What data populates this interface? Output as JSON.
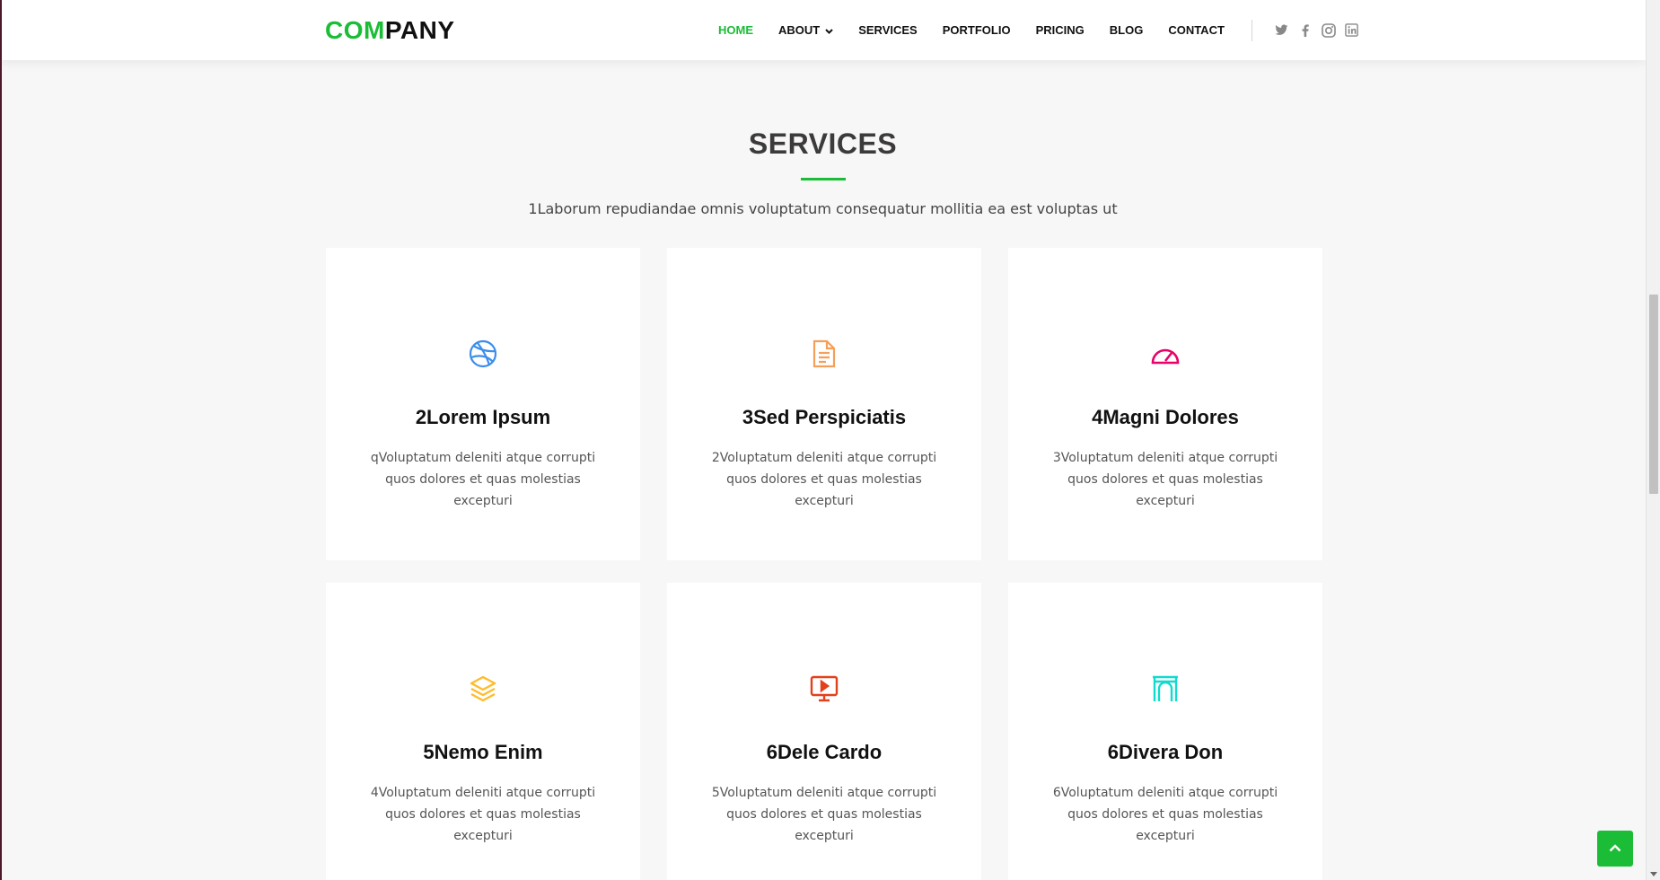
{
  "header": {
    "logo_part1": "COM",
    "logo_part2": "PANY",
    "nav": {
      "home": "HOME",
      "about": "ABOUT",
      "services": "SERVICES",
      "portfolio": "PORTFOLIO",
      "pricing": "PRICING",
      "blog": "BLOG",
      "contact": "CONTACT"
    },
    "social_icons": [
      "twitter-icon",
      "facebook-icon",
      "instagram-icon",
      "linkedin-icon"
    ]
  },
  "section": {
    "title": "SERVICES",
    "subtitle": "1Laborum repudiandae omnis voluptatum consequatur mollitia ea est voluptas ut"
  },
  "cards": [
    {
      "icon": "dribbble-icon",
      "color": "#3b8eea",
      "title": "2Lorem Ipsum",
      "desc": "qVoluptatum deleniti atque corrupti quos dolores et quas molestias excepturi"
    },
    {
      "icon": "document-icon",
      "color": "#f5a05a",
      "title": "3Sed Perspiciatis",
      "desc": "2Voluptatum deleniti atque corrupti quos dolores et quas molestias excepturi"
    },
    {
      "icon": "speedometer-icon",
      "color": "#e80368",
      "title": "4Magni Dolores",
      "desc": "3Voluptatum deleniti atque corrupti quos dolores et quas molestias excepturi"
    },
    {
      "icon": "layers-icon",
      "color": "#ffbb2c",
      "title": "5Nemo Enim",
      "desc": "4Voluptatum deleniti atque corrupti quos dolores et quas molestias excepturi"
    },
    {
      "icon": "presentation-icon",
      "color": "#e2411c",
      "title": "6Dele Cardo",
      "desc": "5Voluptatum deleniti atque corrupti quos dolores et quas molestias excepturi"
    },
    {
      "icon": "arch-icon",
      "color": "#11dbcf",
      "title": "6Divera Don",
      "desc": "6Voluptatum deleniti atque corrupti quos dolores et quas molestias excepturi"
    }
  ],
  "colors": {
    "accent": "#1bbd36",
    "background": "#f7f7f7"
  }
}
